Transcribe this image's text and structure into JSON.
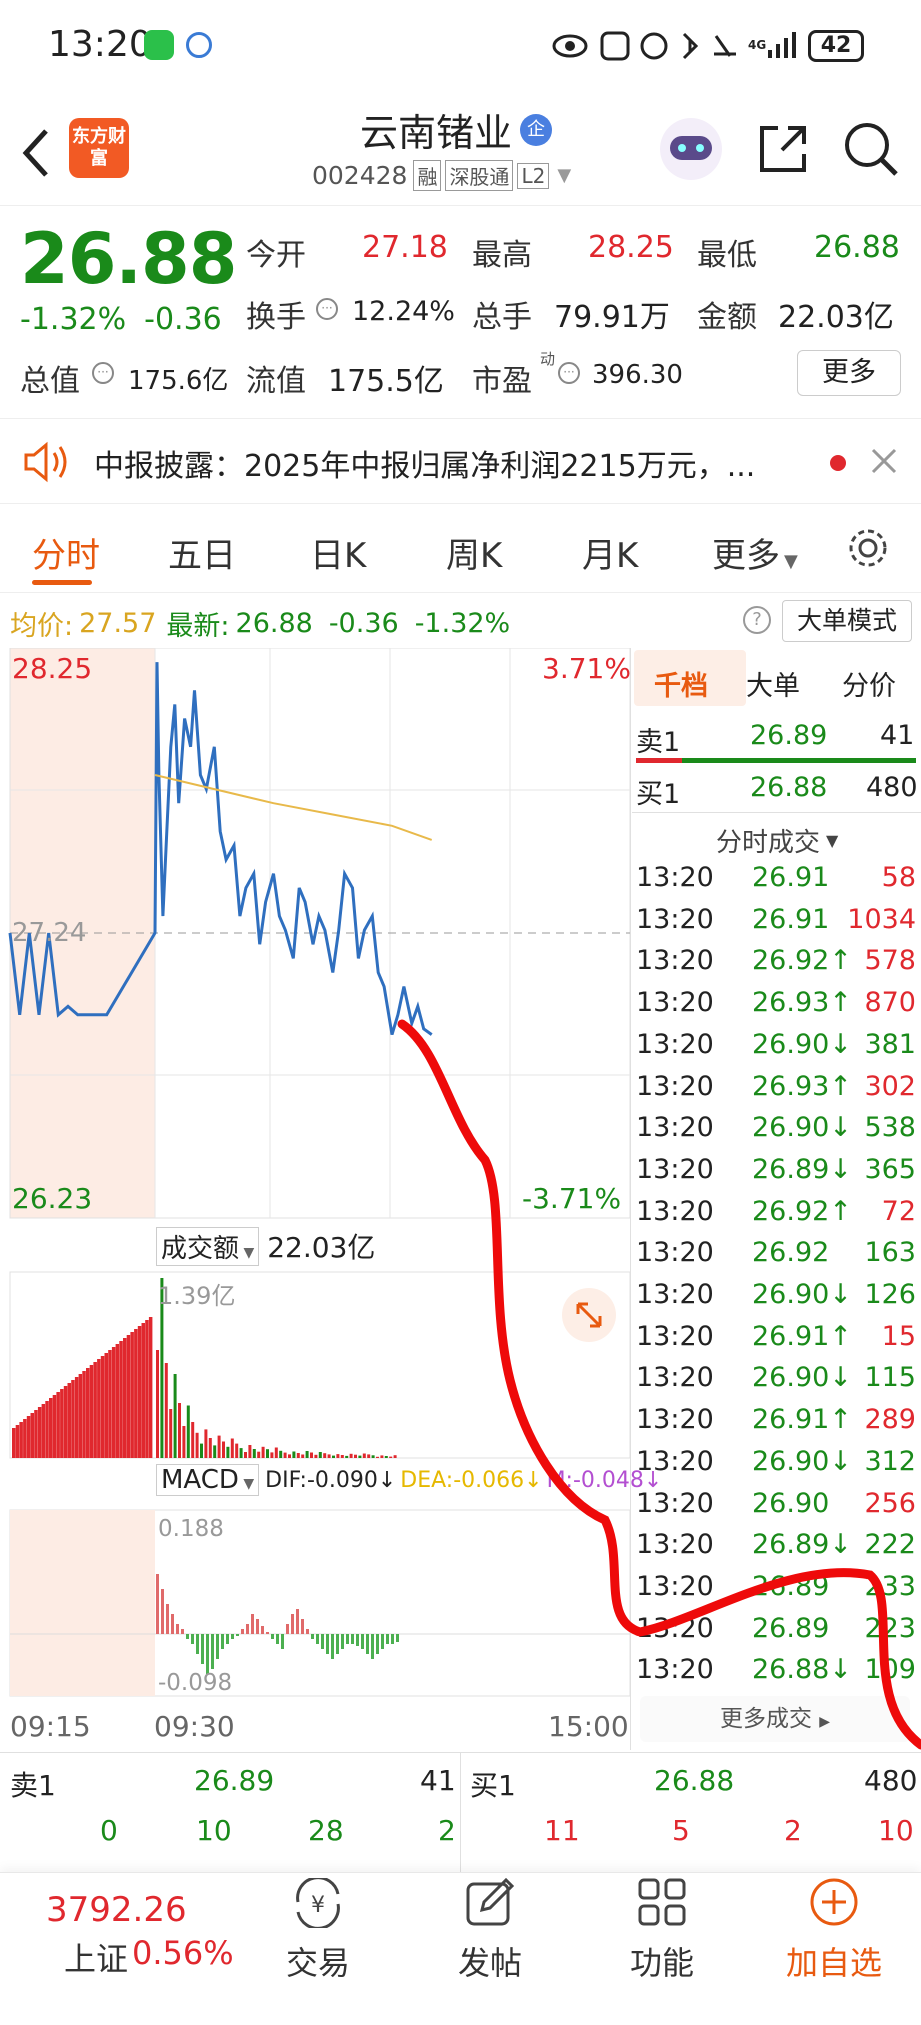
{
  "status_bar": {
    "time": "13:20",
    "network": "4G",
    "battery": "42"
  },
  "header": {
    "logo_text": "东方财富",
    "stock_name": "云南锗业",
    "badge": "企",
    "code": "002428",
    "tags": [
      "融",
      "深股通",
      "L2"
    ]
  },
  "quote": {
    "price": "26.88",
    "change_pct": "-1.32%",
    "change_amt": "-0.36",
    "open_label": "今开",
    "open": "27.18",
    "high_label": "最高",
    "high": "28.25",
    "low_label": "最低",
    "low": "26.88",
    "turnover_label": "换手",
    "turnover": "12.24%",
    "volume_label": "总手",
    "volume": "79.91万",
    "amount_label": "金额",
    "amount": "22.03亿",
    "mktcap_label": "总值",
    "mktcap": "175.6亿",
    "float_label": "流值",
    "float": "175.5亿",
    "pe_label": "市盈",
    "pe_sup": "动",
    "pe": "396.30",
    "more_label": "更多"
  },
  "banner": {
    "text": "中报披露：2025年中报归属净利润2215万元，..."
  },
  "tabs": [
    "分时",
    "五日",
    "日K",
    "周K",
    "月K",
    "更多"
  ],
  "info_line": {
    "avg_label": "均价:",
    "avg": "27.57",
    "latest_label": "最新:",
    "latest": "26.88",
    "chg": "-0.36",
    "chg_pct": "-1.32%",
    "mode_button": "大单模式"
  },
  "chart_labels": {
    "top_price": "28.25",
    "top_pct": "3.71%",
    "mid_price": "27.24",
    "bottom_price": "26.23",
    "bottom_pct": "-3.71%",
    "vol_label": "成交额",
    "vol_value": "22.03亿",
    "vol_max": "1.39亿",
    "macd_label": "MACD",
    "dif": "DIF:-0.090↓",
    "dea": "DEA:-0.066↓",
    "m": "M:-0.048↓",
    "macd_top": "0.188",
    "macd_bottom": "-0.098",
    "time_start": "09:15",
    "time_open": "09:30",
    "time_end": "15:00"
  },
  "chart_data": {
    "type": "line",
    "title": "",
    "series": [
      {
        "name": "",
        "x": [
          "09:15",
          "09:16",
          "09:17",
          "09:18",
          "09:19",
          "09:20",
          "09:21",
          "09:22",
          "09:25",
          "09:30",
          "09:31",
          "09:32",
          "09:34",
          "09:36",
          "09:38",
          "09:40",
          "09:42",
          "09:45",
          "09:48",
          "09:50",
          "09:53",
          "09:56",
          "10:00",
          "10:03",
          "10:06",
          "10:10",
          "10:13",
          "10:16",
          "10:20",
          "10:23",
          "10:26",
          "10:30",
          "10:33",
          "10:36",
          "10:40",
          "10:43",
          "10:46",
          "10:50",
          "10:53",
          "10:56",
          "11:00",
          "11:03",
          "11:06",
          "11:10",
          "11:13",
          "11:16",
          "11:20",
          "11:23",
          "11:26",
          "11:30",
          "13:03",
          "13:06",
          "13:10",
          "13:13",
          "13:16",
          "13:20"
        ],
        "values": [
          27.24,
          26.95,
          27.24,
          26.95,
          27.24,
          26.95,
          26.98,
          26.95,
          26.95,
          27.24,
          28.2,
          27.8,
          27.3,
          27.6,
          27.9,
          28.05,
          27.7,
          28.0,
          27.9,
          28.1,
          27.8,
          27.75,
          27.9,
          27.6,
          27.5,
          27.55,
          27.3,
          27.4,
          27.45,
          27.2,
          27.35,
          27.45,
          27.3,
          27.25,
          27.15,
          27.4,
          27.35,
          27.2,
          27.3,
          27.25,
          27.1,
          27.25,
          27.45,
          27.4,
          27.15,
          27.25,
          27.3,
          27.1,
          27.05,
          26.88,
          26.95,
          27.05,
          26.92,
          26.98,
          26.9,
          26.88
        ]
      },
      {
        "name": "",
        "x": [
          "09:30",
          "10:00",
          "10:30",
          "11:00",
          "11:30",
          "13:20"
        ],
        "values": [
          27.8,
          27.75,
          27.7,
          27.66,
          27.62,
          27.57
        ]
      }
    ],
    "ylim": [
      26.23,
      28.25
    ],
    "xlabel": "",
    "ylabel": ""
  },
  "right_panel": {
    "tabs": [
      "千档",
      "大单",
      "分价"
    ],
    "sell1_label": "卖1",
    "sell1_price": "26.89",
    "sell1_vol": "41",
    "buy1_label": "买1",
    "buy1_price": "26.88",
    "buy1_vol": "480",
    "trades_header": "分时成交",
    "trades": [
      {
        "t": "13:20",
        "p": "26.91",
        "v": "58",
        "pc": "green",
        "vc": "red"
      },
      {
        "t": "13:20",
        "p": "26.91",
        "v": "1034",
        "pc": "green",
        "vc": "red"
      },
      {
        "t": "13:20",
        "p": "26.92↑",
        "v": "578",
        "pc": "green",
        "vc": "red"
      },
      {
        "t": "13:20",
        "p": "26.93↑",
        "v": "870",
        "pc": "green",
        "vc": "red"
      },
      {
        "t": "13:20",
        "p": "26.90↓",
        "v": "381",
        "pc": "green",
        "vc": "green"
      },
      {
        "t": "13:20",
        "p": "26.93↑",
        "v": "302",
        "pc": "green",
        "vc": "red"
      },
      {
        "t": "13:20",
        "p": "26.90↓",
        "v": "538",
        "pc": "green",
        "vc": "green"
      },
      {
        "t": "13:20",
        "p": "26.89↓",
        "v": "365",
        "pc": "green",
        "vc": "green"
      },
      {
        "t": "13:20",
        "p": "26.92↑",
        "v": "72",
        "pc": "green",
        "vc": "red"
      },
      {
        "t": "13:20",
        "p": "26.92",
        "v": "163",
        "pc": "green",
        "vc": "green"
      },
      {
        "t": "13:20",
        "p": "26.90↓",
        "v": "126",
        "pc": "green",
        "vc": "green"
      },
      {
        "t": "13:20",
        "p": "26.91↑",
        "v": "15",
        "pc": "green",
        "vc": "red"
      },
      {
        "t": "13:20",
        "p": "26.90↓",
        "v": "115",
        "pc": "green",
        "vc": "green"
      },
      {
        "t": "13:20",
        "p": "26.91↑",
        "v": "289",
        "pc": "green",
        "vc": "red"
      },
      {
        "t": "13:20",
        "p": "26.90↓",
        "v": "312",
        "pc": "green",
        "vc": "green"
      },
      {
        "t": "13:20",
        "p": "26.90",
        "v": "256",
        "pc": "green",
        "vc": "red"
      },
      {
        "t": "13:20",
        "p": "26.89↓",
        "v": "222",
        "pc": "green",
        "vc": "green"
      },
      {
        "t": "13:20",
        "p": "26.89",
        "v": "233",
        "pc": "green",
        "vc": "green"
      },
      {
        "t": "13:20",
        "p": "26.89",
        "v": "223",
        "pc": "green",
        "vc": "green"
      },
      {
        "t": "13:20",
        "p": "26.88↓",
        "v": "109",
        "pc": "green",
        "vc": "green"
      }
    ],
    "more_trades": "更多成交"
  },
  "order_book": {
    "sell_label": "卖1",
    "sell_price": "26.89",
    "sell_vol": "41",
    "sell_nums": [
      "0",
      "10",
      "28",
      "2"
    ],
    "buy_label": "买1",
    "buy_price": "26.88",
    "buy_vol": "480",
    "buy_nums": [
      "11",
      "5",
      "2",
      "10"
    ]
  },
  "bottom_nav": {
    "index_value": "3792.26",
    "index_name": "上证",
    "index_pct": "0.56%",
    "items": [
      "交易",
      "发帖",
      "功能",
      "加自选"
    ]
  },
  "colors": {
    "up": "#e0282e",
    "down": "#1a8a1a",
    "accent": "#e85a10",
    "price_line": "#2f6fbf",
    "avg_line": "#e8b94a"
  }
}
